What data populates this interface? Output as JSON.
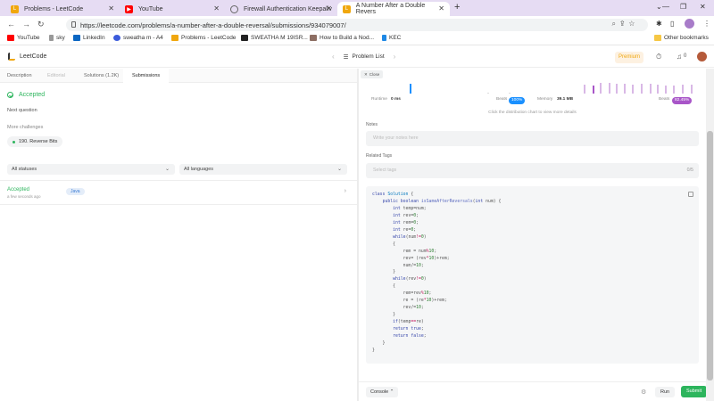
{
  "browser": {
    "tabs": [
      {
        "title": "Problems - LeetCode",
        "active": false
      },
      {
        "title": "YouTube",
        "active": false
      },
      {
        "title": "Firewall Authentication Keepaliv",
        "active": false
      },
      {
        "title": "A Number After a Double Revers",
        "active": true
      }
    ],
    "url": "https://leetcode.com/problems/a-number-after-a-double-reversal/submissions/934079007/",
    "bookmarks": [
      "YouTube",
      "sky",
      "LinkedIn",
      "sweatha m - A4",
      "Problems - LeetCode",
      "SWEATHA M 19ISR...",
      "How to Build a Nod...",
      "KEC"
    ],
    "other_bookmarks": "Other bookmarks"
  },
  "leetcode": {
    "logo": "LeetCode",
    "problem_list": "Problem List",
    "premium": "Premium",
    "notifications": "0"
  },
  "left": {
    "tabs": [
      "Description",
      "Editorial",
      "Solutions (1.2K)",
      "Submissions"
    ],
    "status": "Accepted",
    "next_question": "Next question",
    "more_challenges": "More challenges",
    "challenge": "190. Reverse Bits",
    "filter_status": "All statuses",
    "filter_language": "All languages",
    "submission": {
      "status": "Accepted",
      "time": "a few seconds ago",
      "language": "Java"
    }
  },
  "right": {
    "close": "Close",
    "runtime_label": "Runtime",
    "runtime_value": "0 ms",
    "beats_label": "Beats",
    "beats_runtime": "100%",
    "memory_label": "Memory",
    "memory_value": "39.1 MB",
    "beats_memory": "82.45%",
    "hint": "Click the distribution chart to view more details",
    "notes_label": "Notes",
    "notes_placeholder": "Write your notes here",
    "tags_label": "Related Tags",
    "tags_placeholder": "Select tags",
    "tags_count": "0/5",
    "console": "Console",
    "run": "Run",
    "submit": "Submit"
  },
  "colors": {
    "accepted": "#2db55d",
    "premium": "#f0a70e",
    "runtime_badge": "#1a90ff",
    "memory_badge": "#a855c8"
  },
  "icons": [
    "youtube-icon",
    "linkedin-icon",
    "lock-icon",
    "search-icon",
    "share-icon",
    "star-icon",
    "puzzle-icon",
    "check-circle-icon",
    "copy-icon",
    "gear-icon",
    "bell-icon",
    "timer-icon"
  ]
}
